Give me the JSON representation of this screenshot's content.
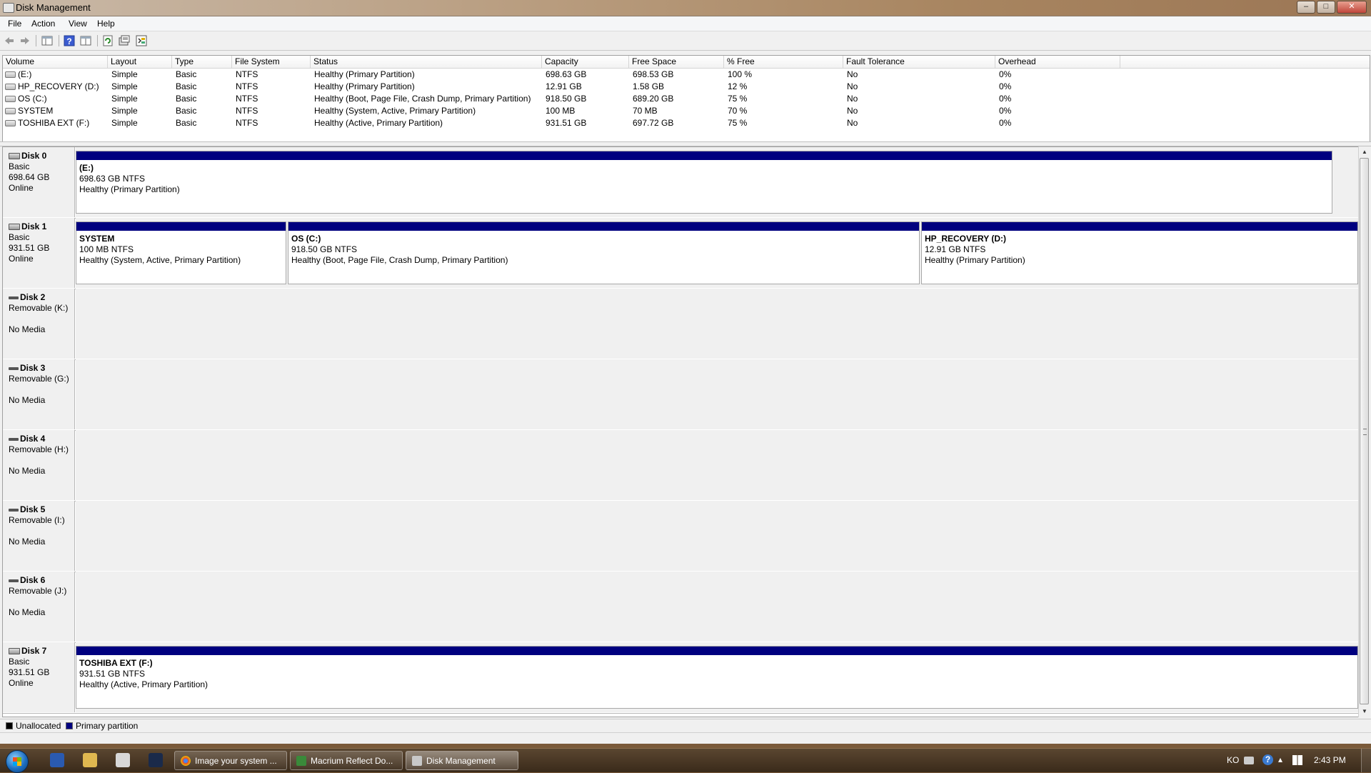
{
  "window": {
    "title": "Disk Management"
  },
  "menu": [
    "File",
    "Action",
    "View",
    "Help"
  ],
  "toolbar_icons": [
    "back-icon",
    "forward-icon",
    "show-hide-console-tree-icon",
    "help-icon",
    "properties-view-icon",
    "refresh-icon",
    "rescan-disks-icon",
    "settings-icon"
  ],
  "volume_table": {
    "columns": [
      "Volume",
      "Layout",
      "Type",
      "File System",
      "Status",
      "Capacity",
      "Free Space",
      "% Free",
      "Fault Tolerance",
      "Overhead"
    ],
    "rows": [
      [
        "(E:)",
        "Simple",
        "Basic",
        "NTFS",
        "Healthy (Primary Partition)",
        "698.63 GB",
        "698.53 GB",
        "100 %",
        "No",
        "0%"
      ],
      [
        "HP_RECOVERY (D:)",
        "Simple",
        "Basic",
        "NTFS",
        "Healthy (Primary Partition)",
        "12.91 GB",
        "1.58 GB",
        "12 %",
        "No",
        "0%"
      ],
      [
        "OS (C:)",
        "Simple",
        "Basic",
        "NTFS",
        "Healthy (Boot, Page File, Crash Dump, Primary Partition)",
        "918.50 GB",
        "689.20 GB",
        "75 %",
        "No",
        "0%"
      ],
      [
        "SYSTEM",
        "Simple",
        "Basic",
        "NTFS",
        "Healthy (System, Active, Primary Partition)",
        "100 MB",
        "70 MB",
        "70 %",
        "No",
        "0%"
      ],
      [
        "TOSHIBA EXT (F:)",
        "Simple",
        "Basic",
        "NTFS",
        "Healthy (Active, Primary Partition)",
        "931.51 GB",
        "697.72 GB",
        "75 %",
        "No",
        "0%"
      ]
    ]
  },
  "disks": [
    {
      "name": "Disk 0",
      "line1": "Basic",
      "line2": "698.64 GB",
      "line3": "Online",
      "partitions": [
        {
          "name": "(E:)",
          "size": "698.63 GB NTFS",
          "status": "Healthy (Primary Partition)"
        }
      ]
    },
    {
      "name": "Disk 1",
      "line1": "Basic",
      "line2": "931.51 GB",
      "line3": "Online",
      "partitions": [
        {
          "name": "SYSTEM",
          "size": "100 MB NTFS",
          "status": "Healthy (System, Active, Primary Partition)"
        },
        {
          "name": "OS  (C:)",
          "size": "918.50 GB NTFS",
          "status": "Healthy (Boot, Page File, Crash Dump, Primary Partition)"
        },
        {
          "name": "HP_RECOVERY  (D:)",
          "size": "12.91 GB NTFS",
          "status": "Healthy (Primary Partition)"
        }
      ]
    },
    {
      "name": "Disk 2",
      "line1": "Removable (K:)",
      "line2": "",
      "line3": "No Media",
      "partitions": []
    },
    {
      "name": "Disk 3",
      "line1": "Removable (G:)",
      "line2": "",
      "line3": "No Media",
      "partitions": []
    },
    {
      "name": "Disk 4",
      "line1": "Removable (H:)",
      "line2": "",
      "line3": "No Media",
      "partitions": []
    },
    {
      "name": "Disk 5",
      "line1": "Removable (I:)",
      "line2": "",
      "line3": "No Media",
      "partitions": []
    },
    {
      "name": "Disk 6",
      "line1": "Removable (J:)",
      "line2": "",
      "line3": "No Media",
      "partitions": []
    },
    {
      "name": "Disk 7",
      "line1": "Basic",
      "line2": "931.51 GB",
      "line3": "Online",
      "partitions": [
        {
          "name": "TOSHIBA EXT  (F:)",
          "size": "931.51 GB NTFS",
          "status": "Healthy (Active, Primary Partition)"
        }
      ]
    }
  ],
  "legend": [
    {
      "label": "Unallocated",
      "color": "#000000"
    },
    {
      "label": "Primary partition",
      "color": "#00007f"
    }
  ],
  "taskbar": {
    "buttons": [
      "Image your system ...",
      "Macrium Reflect Do...",
      "Disk Management"
    ],
    "active": "Disk Management",
    "tray_lang": "KO",
    "clock": "2:43 PM"
  },
  "colors": {
    "primary_partition": "#00007f",
    "window_bg": "#f0f0f0"
  }
}
